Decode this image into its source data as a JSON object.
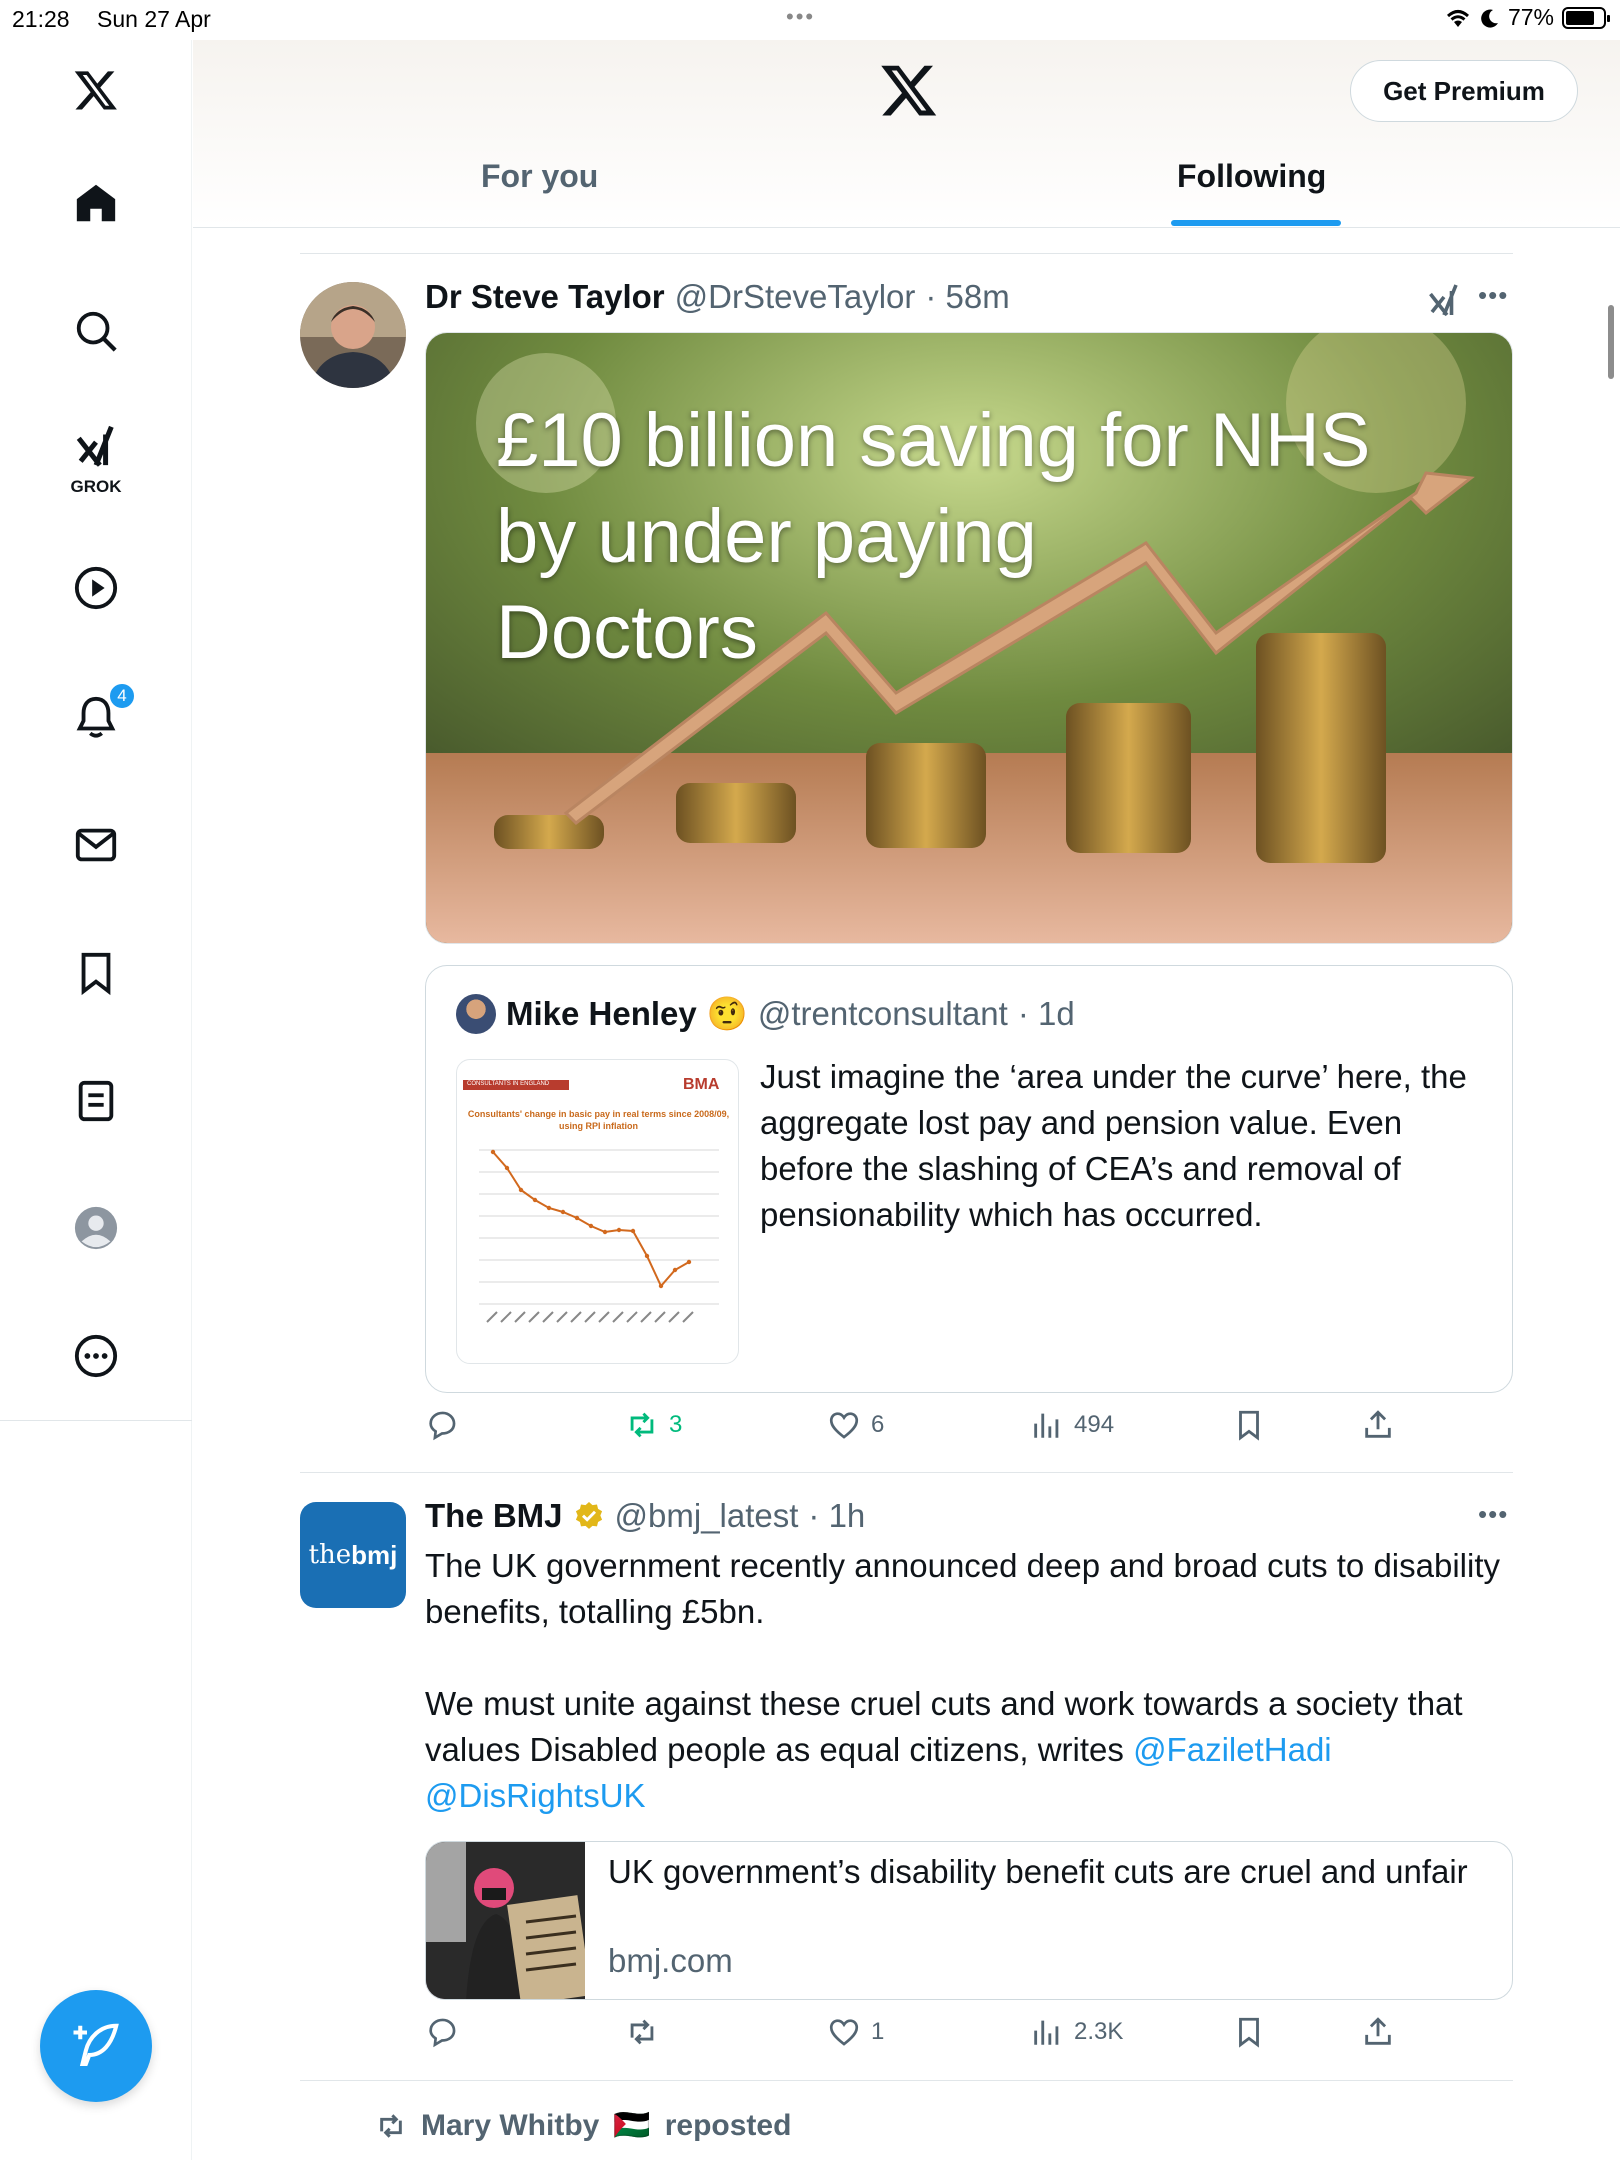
{
  "status_bar": {
    "time": "21:28",
    "date": "Sun 27 Apr",
    "battery": "77%",
    "battery_level": 0.77
  },
  "sidebar": {
    "grok_label": "GROK",
    "notifications_badge": "4",
    "items": [
      "x-logo-icon",
      "home-icon",
      "search-icon",
      "grok-icon",
      "video-icon",
      "notifications-icon",
      "messages-icon",
      "bookmarks-icon",
      "lists-icon",
      "profile-icon",
      "more-icon"
    ]
  },
  "header": {
    "premium_label": "Get Premium",
    "tabs": [
      {
        "label": "For you",
        "active": false
      },
      {
        "label": "Following",
        "active": true
      }
    ]
  },
  "posts": [
    {
      "name": "Dr Steve Taylor",
      "handle": "@DrSteveTaylor",
      "time": "· 58m",
      "image_text": "£10 billion saving for NHS\nby under paying\nDoctors",
      "quote": {
        "name": "Mike Henley",
        "emoji": "🤨",
        "handle": "@trentconsultant",
        "time": "· 1d",
        "chart_header": "CONSULTANTS IN ENGLAND",
        "chart_brand": "BMA",
        "chart_title": "Consultants' change in basic pay in real terms since 2008/09, using RPI inflation",
        "text": "Just imagine the ‘area under the curve’ here, the aggregate lost pay and pension value. Even before the slashing of CEA’s and removal of pensionability which has occurred."
      },
      "stats": {
        "replies": "",
        "reposts": "3",
        "likes": "6",
        "views": "494"
      }
    },
    {
      "name": "The BMJ",
      "handle": "@bmj_latest",
      "time": "· 1h",
      "logo_text_a": "the",
      "logo_text_b": "bmj",
      "text_1": "The UK government recently announced deep and broad cuts to disability benefits, totalling £5bn.",
      "text_2": "We must unite against these cruel cuts and work towards a society that values Disabled people as equal citizens, writes ",
      "mention_1": "@FaziletHadi",
      "mention_2": "@DisRightsUK",
      "link": {
        "title": "UK government’s disability benefit cuts are cruel and unfair",
        "domain": "bmj.com"
      },
      "stats": {
        "replies": "",
        "reposts": "",
        "likes": "1",
        "views": "2.3K"
      }
    }
  ],
  "repost_banner": {
    "name": "Mary Whitby",
    "flag": "🇵🇸",
    "suffix": "reposted"
  }
}
